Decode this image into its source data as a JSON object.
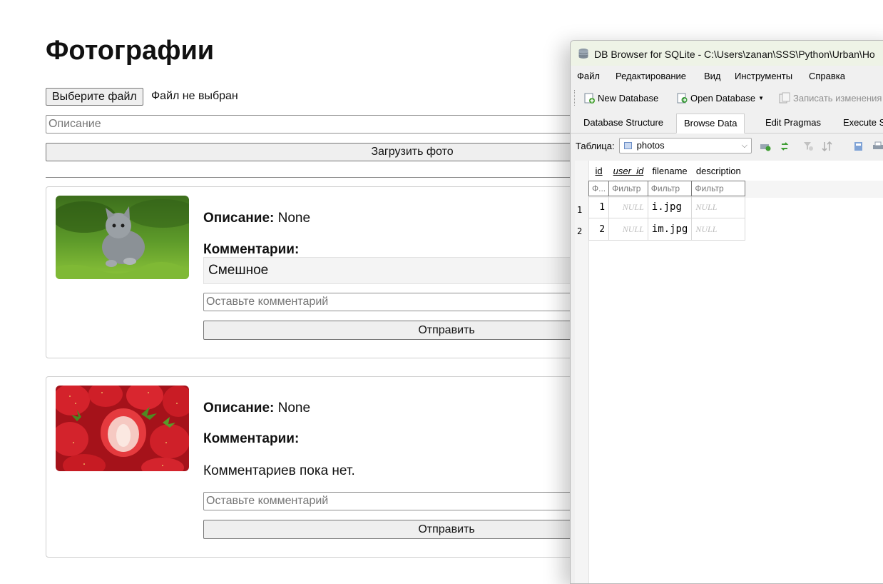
{
  "page": {
    "title": "Фотографии",
    "file_button": "Выберите файл",
    "file_status": "Файл не выбран",
    "description_placeholder": "Описание",
    "upload_button": "Загрузить фото",
    "cards": [
      {
        "image": "kitten-on-grass",
        "description_label": "Описание:",
        "description_value": "None",
        "comments_label": "Комментарии:",
        "comments": [
          "Смешное"
        ],
        "comment_placeholder": "Оставьте комментарий",
        "send_button": "Отправить"
      },
      {
        "image": "strawberries",
        "description_label": "Описание:",
        "description_value": "None",
        "comments_label": "Комментарии:",
        "no_comments": "Комментариев пока нет.",
        "comment_placeholder": "Оставьте комментарий",
        "send_button": "Отправить"
      }
    ]
  },
  "db_window": {
    "title": "DB Browser for SQLite - C:\\Users\\zanan\\SSS\\Python\\Urban\\Ho",
    "menu": [
      "Файл",
      "Редактирование",
      "Вид",
      "Инструменты",
      "Справка"
    ],
    "toolbar": {
      "new_database": "New Database",
      "open_database": "Open Database",
      "write_changes": "Записать изменения"
    },
    "tabs": [
      "Database Structure",
      "Browse Data",
      "Edit Pragmas",
      "Execute S"
    ],
    "active_tab": "Browse Data",
    "table_label": "Таблица:",
    "table_selected": "photos",
    "columns": [
      "id",
      "user_id",
      "filename",
      "description"
    ],
    "filters": [
      "Ф...",
      "Фильтр",
      "Фильтр",
      "Фильтр"
    ],
    "rows": [
      {
        "rownum": "1",
        "id": "1",
        "user_id": "NULL",
        "filename": "i.jpg",
        "description": "NULL"
      },
      {
        "rownum": "2",
        "id": "2",
        "user_id": "NULL",
        "filename": "im.jpg",
        "description": "NULL"
      }
    ],
    "colors": {
      "titlebar": "#eef3e6",
      "active_tab": "#ffffff",
      "null_text": "#bdbdbd"
    }
  }
}
